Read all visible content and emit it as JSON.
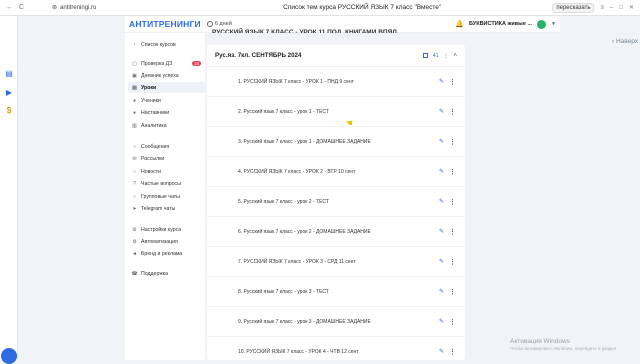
{
  "browser": {
    "back": "←",
    "reload": "C",
    "url": "antitreningi.ru",
    "title": "Список тем курса РУССКИЙ ЯЗЫК 7 класс \"Вместе\"",
    "share": "пересказать"
  },
  "header": {
    "logo": "АНТИТРЕНИНГИ",
    "days": "6 дней",
    "user_name": "БУКВИСТИКА живые ..."
  },
  "back_link": "Наверх",
  "previous_section_title": "РУССКИЙ ЯЗЫК 7 КЛАСС - УРОК 11 ПОД. КНИГАМИ ВПЯЛ",
  "sidebar": {
    "courses_back": "Список курсов",
    "items": [
      {
        "label": "Проверка ДЗ",
        "badge": "18"
      },
      {
        "label": "Дневник успеха"
      },
      {
        "label": "Уроки"
      },
      {
        "label": "Ученики"
      },
      {
        "label": "Наставники"
      },
      {
        "label": "Аналитика"
      },
      {
        "label": "Сообщения"
      },
      {
        "label": "Рассылки"
      },
      {
        "label": "Новости"
      },
      {
        "label": "Частые вопросы"
      },
      {
        "label": "Групповые чаты"
      },
      {
        "label": "Telegram чаты"
      },
      {
        "label": "Настройки курса"
      },
      {
        "label": "Автоматизация"
      },
      {
        "label": "Бренд и реклама"
      },
      {
        "label": "Поддержка"
      }
    ]
  },
  "section": {
    "title": "Рус.яз. 7кл. СЕНТЯБРЬ 2024",
    "count": "41"
  },
  "lessons": [
    "1. РУССКИЙ ЯЗЫК 7 класс - УРОК 1 - ПНД 9 сент",
    "2. Русский язык 7 класс - урок 1 - ТЕСТ",
    "3. Русский язык 7 класс - урок 1 - ДОМАШНЕЕ ЗАДАНИЕ",
    "4. РУССКИЙ ЯЗЫК 7 класс - УРОК 2 - ВТР 10 сент",
    "5. Русский язык 7 класс - урок 2 - ТЕСТ",
    "6. Русский язык 7 класс - урок 2 - ДОМАШНЕЕ ЗАДАНИЕ",
    "7. РУССКИЙ ЯЗЫК 7 класс - УРОК 3 - СРД 11 сент",
    "8. Русский язык 7 класс - урок 3 - ТЕСТ",
    "9. Русский язык 7 класс - урок 3 - ДОМАШНЕЕ ЗАДАНИЕ",
    "10. РУССКИЙ ЯЗЫК 7 класс - УРОК 4 - ЧТВ 12 сент"
  ],
  "watermark": {
    "title": "Активация Windows",
    "sub": "Чтобы активировать Windows, перейдите в раздел"
  },
  "colors": {
    "accent": "#2f6be0",
    "badge": "#e43f5a"
  }
}
